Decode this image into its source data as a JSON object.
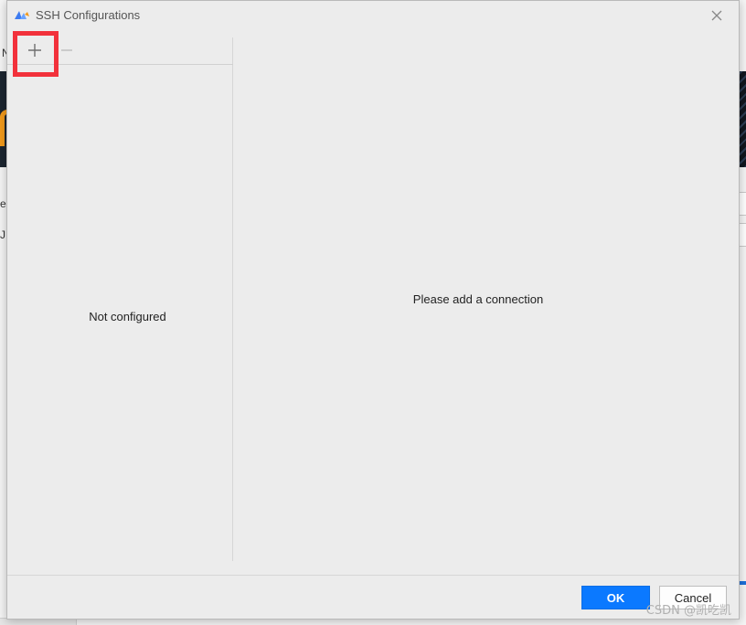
{
  "background": {
    "fragment_top": "N",
    "fragment_mid1": "ec",
    "fragment_mid2": "J"
  },
  "dialog": {
    "title": "SSH Configurations",
    "colors": {
      "accent": "#0b79ff",
      "highlight": "#f2313b"
    }
  },
  "toolbar": {
    "add_icon": "plus-icon",
    "remove_icon": "minus-icon"
  },
  "list": {
    "empty_text": "Not configured"
  },
  "detail": {
    "empty_text": "Please add a connection"
  },
  "footer": {
    "ok_label": "OK",
    "cancel_label": "Cancel"
  },
  "watermark": "CSDN @凯吃凯"
}
